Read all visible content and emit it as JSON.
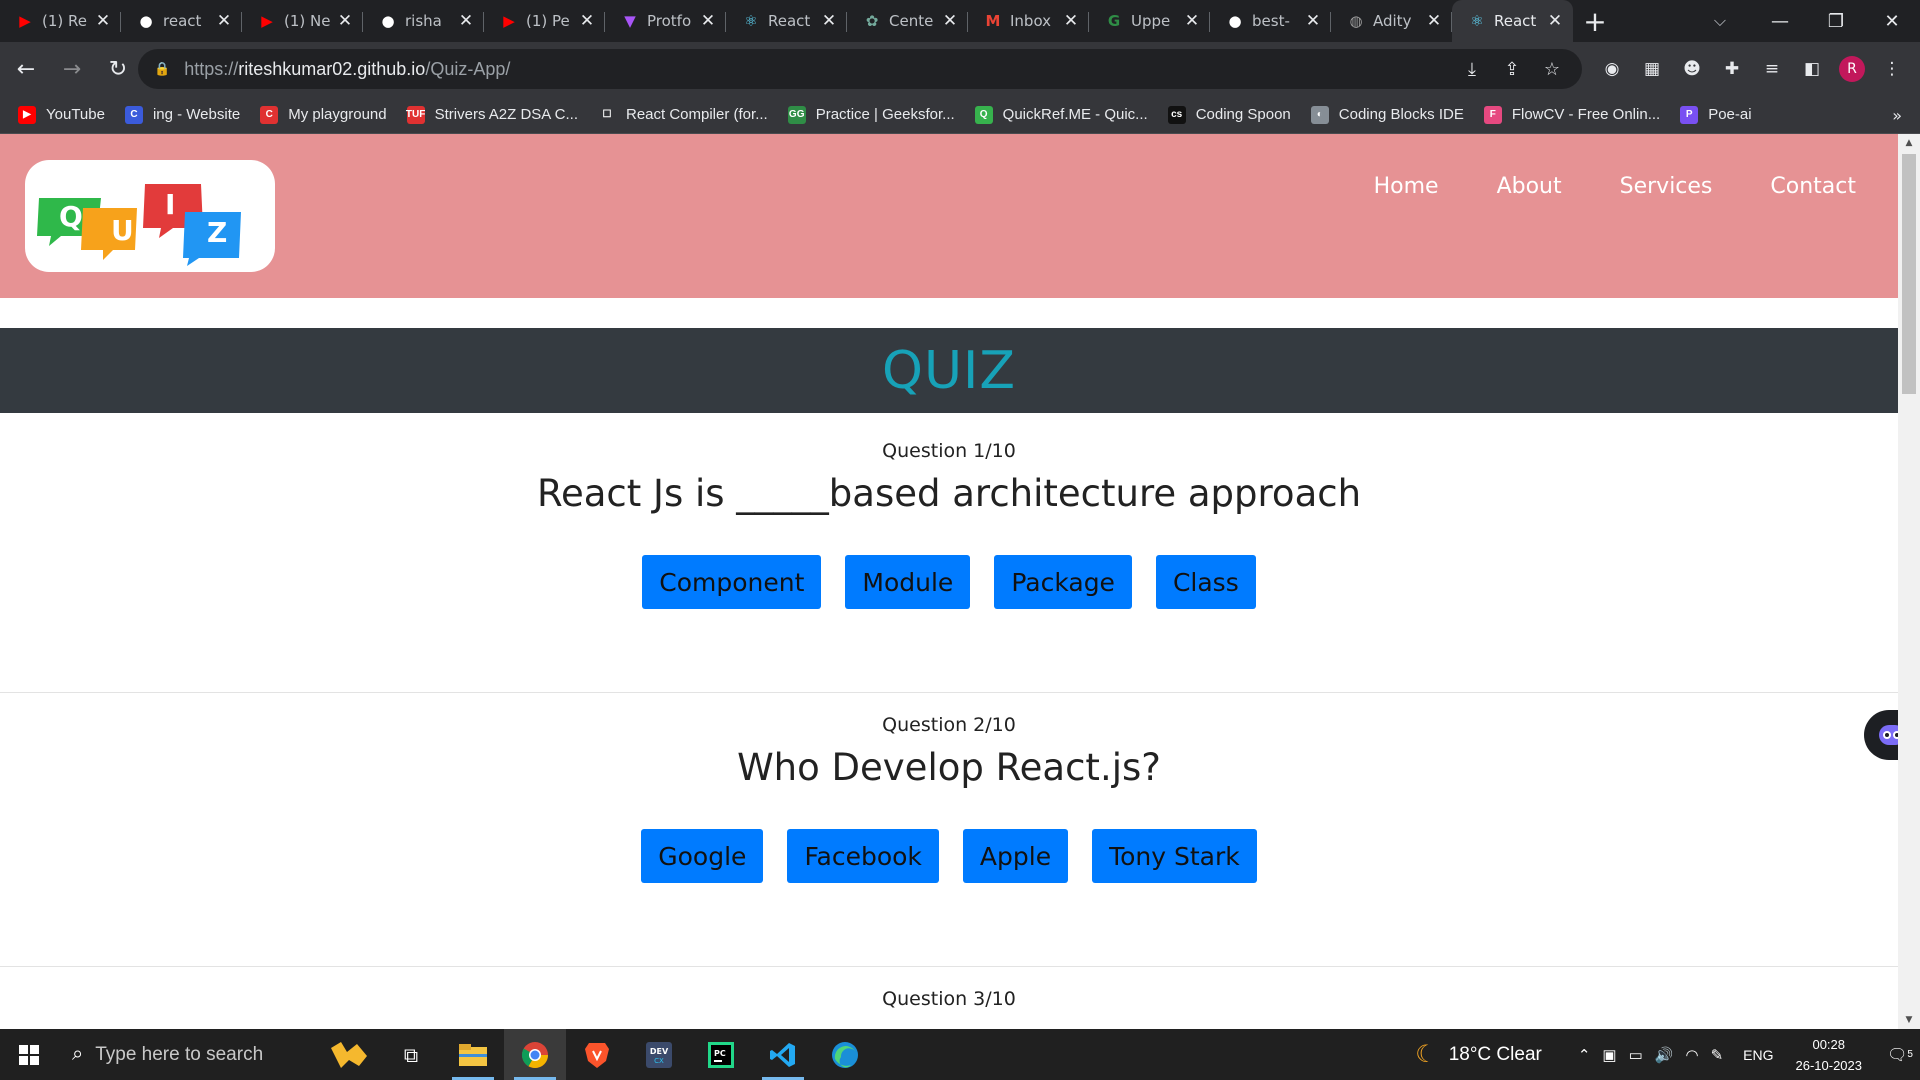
{
  "browser": {
    "tabs": [
      {
        "title": "(1) Re",
        "icon": "youtube-icon",
        "color": "#ff0000"
      },
      {
        "title": "react",
        "icon": "github-icon",
        "color": "#ffffff"
      },
      {
        "title": "(1) Ne",
        "icon": "youtube-icon",
        "color": "#ff0000"
      },
      {
        "title": "risha",
        "icon": "github-icon",
        "color": "#ffffff"
      },
      {
        "title": "(1) Pe",
        "icon": "youtube-icon",
        "color": "#ff0000"
      },
      {
        "title": "Protfo",
        "icon": "vite-icon",
        "color": "#a855f7"
      },
      {
        "title": "React",
        "icon": "react-icon",
        "color": "#61dafb"
      },
      {
        "title": "Cente",
        "icon": "openai-icon",
        "color": "#74aa9c"
      },
      {
        "title": "Inbox",
        "icon": "gmail-icon",
        "color": "#ea4335"
      },
      {
        "title": "Uppe",
        "icon": "geeksforgeeks-icon",
        "color": "#2f8d46"
      },
      {
        "title": "best-",
        "icon": "github-icon",
        "color": "#ffffff"
      },
      {
        "title": "Adity",
        "icon": "profile-icon",
        "color": "#9e9e9e"
      },
      {
        "title": "React",
        "icon": "react-icon",
        "color": "#61dafb",
        "active": true
      }
    ],
    "url_host": "riteshkumar02.github.io",
    "url_path": "/Quiz-App/",
    "url_scheme": "https://",
    "avatar_letter": "R",
    "bookmarks": [
      {
        "label": "YouTube",
        "color": "#ff0000",
        "glyph": "▶"
      },
      {
        "label": "ing - Website",
        "color": "#3b5bdb",
        "glyph": "C"
      },
      {
        "label": "My playground",
        "color": "#e03131",
        "glyph": "C"
      },
      {
        "label": "Strivers A2Z DSA C...",
        "color": "#e03131",
        "glyph": "TUF"
      },
      {
        "label": "React Compiler (for...",
        "color": "#35363a",
        "glyph": "☐"
      },
      {
        "label": "Practice | Geeksfor...",
        "color": "#2f8d46",
        "glyph": "GG"
      },
      {
        "label": "QuickRef.ME - Quic...",
        "color": "#37b24d",
        "glyph": "Q"
      },
      {
        "label": "Coding Spoon",
        "color": "#111111",
        "glyph": "cs"
      },
      {
        "label": "Coding Blocks IDE",
        "color": "#868e96",
        "glyph": "◐"
      },
      {
        "label": "FlowCV - Free Onlin...",
        "color": "#e64980",
        "glyph": "F"
      },
      {
        "label": "Poe-ai",
        "color": "#7950f2",
        "glyph": "P"
      }
    ]
  },
  "site": {
    "logo_letters": [
      "Q",
      "U",
      "I",
      "Z"
    ],
    "nav": [
      "Home",
      "About",
      "Services",
      "Contact"
    ],
    "banner_title": "QUIZ",
    "colors": {
      "header": "#e69294",
      "banner": "#343a40",
      "title": "#17a2b8",
      "button": "#007bff"
    }
  },
  "questions": [
    {
      "count": "Question 1/10",
      "text": "React Js is _____based architecture approach",
      "options": [
        "Component",
        "Module",
        "Package",
        "Class"
      ]
    },
    {
      "count": "Question 2/10",
      "text": "Who Develop React.js?",
      "options": [
        "Google",
        "Facebook",
        "Apple",
        "Tony Stark"
      ]
    },
    {
      "count": "Question 3/10"
    }
  ],
  "taskbar": {
    "search_placeholder": "Type here to search",
    "weather": "18°C  Clear",
    "lang": "ENG",
    "time": "00:28",
    "date": "26-10-2023",
    "notifications": "5"
  }
}
